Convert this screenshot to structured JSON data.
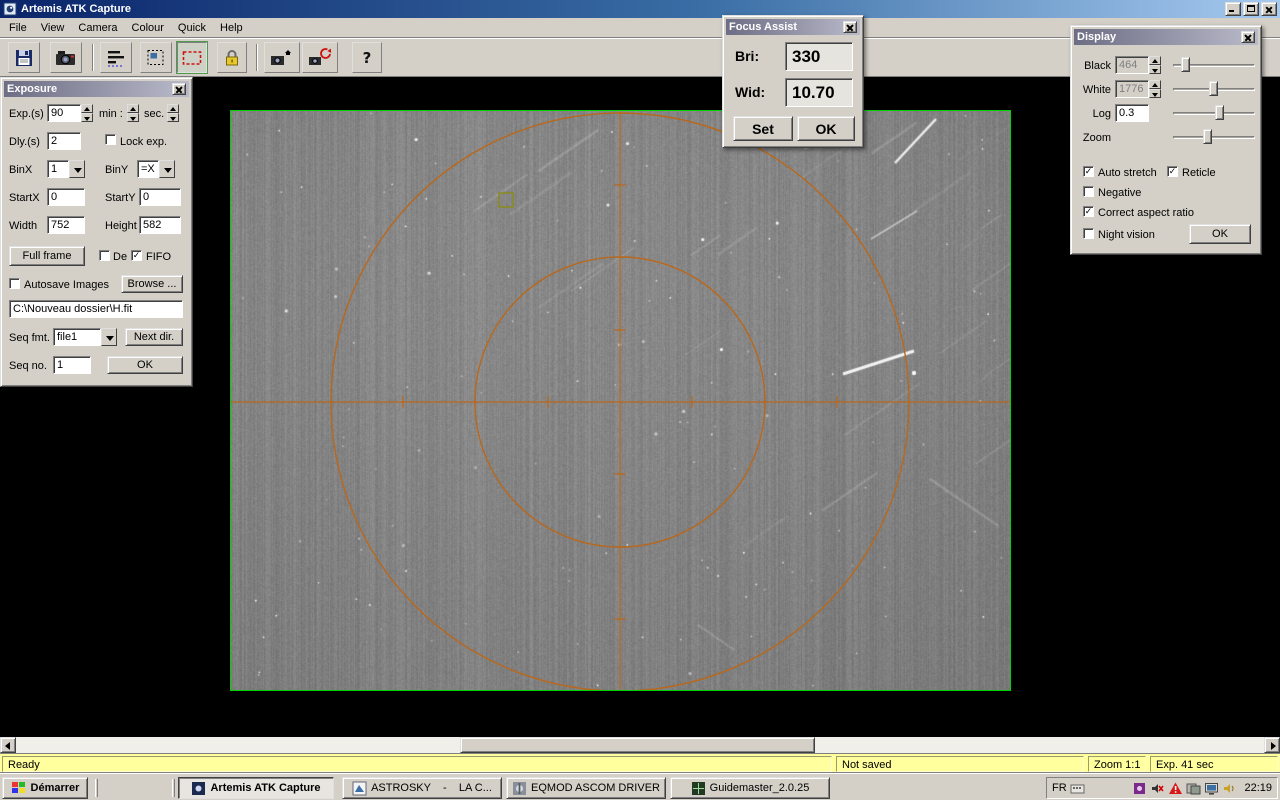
{
  "titlebar": {
    "title": "Artemis ATK Capture"
  },
  "menu": {
    "items": [
      "File",
      "View",
      "Camera",
      "Colour",
      "Quick",
      "Help"
    ]
  },
  "toolbar": {
    "icons": [
      "save",
      "camera-connect",
      "levels",
      "select-area",
      "subframe-toggle",
      "lock",
      "loop-capture",
      "loop-refresh",
      "help"
    ],
    "help_glyph": "?"
  },
  "exposure": {
    "title": "Exposure",
    "exp_label": "Exp.(s)",
    "exp_value": "90",
    "min_label": "min :",
    "sec_label": "sec.",
    "dly_label": "Dly.(s)",
    "dly_value": "2",
    "lock_exp_label": "Lock exp.",
    "lock_exp_check": "",
    "binx_label": "BinX",
    "binx_value": "1",
    "biny_label": "BinY",
    "biny_value": "=X",
    "startx_label": "StartX",
    "startx_value": "0",
    "starty_label": "StartY",
    "starty_value": "0",
    "width_label": "Width",
    "width_value": "752",
    "height_label": "Height",
    "height_value": "582",
    "full_frame_label": "Full frame",
    "del_label": "De",
    "del_check": "",
    "fifo_label": "FIFO",
    "fifo_check": "✓",
    "autosave_label": "Autosave Images",
    "autosave_check": "",
    "browse_label": "Browse ...",
    "path_value": "C:\\Nouveau dossier\\H.fit",
    "seq_fmt_label": "Seq fmt.",
    "seq_fmt_value": "file1",
    "next_dir_label": "Next dir.",
    "seq_no_label": "Seq no.",
    "seq_no_value": "1",
    "ok_label": "OK"
  },
  "focus_assist": {
    "title": "Focus Assist",
    "bri_label": "Bri:",
    "bri_value": "330",
    "wid_label": "Wid:",
    "wid_value": "10.70",
    "set_label": "Set",
    "ok_label": "OK"
  },
  "display": {
    "title": "Display",
    "black_label": "Black",
    "black_value": "464",
    "white_label": "White",
    "white_value": "1776",
    "log_label": "Log",
    "log_value": "0.3",
    "zoom_label": "Zoom",
    "auto_stretch_label": "Auto stretch",
    "auto_stretch_check": "✓",
    "reticle_label": "Reticle",
    "reticle_check": "✓",
    "negative_label": "Negative",
    "negative_check": "",
    "correct_aspect_label": "Correct aspect ratio",
    "correct_aspect_check": "✓",
    "night_vision_label": "Night vision",
    "night_vision_check": "",
    "ok_label": "OK"
  },
  "statusbar": {
    "ready": "Ready",
    "saved": "Not saved",
    "zoom": "Zoom 1:1",
    "exposure": "Exp. 41 sec"
  },
  "taskbar": {
    "start_label": "Démarrer",
    "tasks": [
      {
        "label": "Artemis ATK Capture"
      },
      {
        "label": "ASTROSKY    -    LA C..."
      },
      {
        "label": "EQMOD ASCOM DRIVER"
      },
      {
        "label": "Guidemaster_2.0.25"
      }
    ],
    "tray": {
      "language": "FR",
      "time": "22:19"
    }
  },
  "colors": {
    "reticle": "#b8681c",
    "image_border": "#00d400",
    "status_bg": "#ffff9e",
    "chrome": "#d4d0c8",
    "title_active_left": "#0a246a",
    "title_active_right": "#a6caf0"
  }
}
